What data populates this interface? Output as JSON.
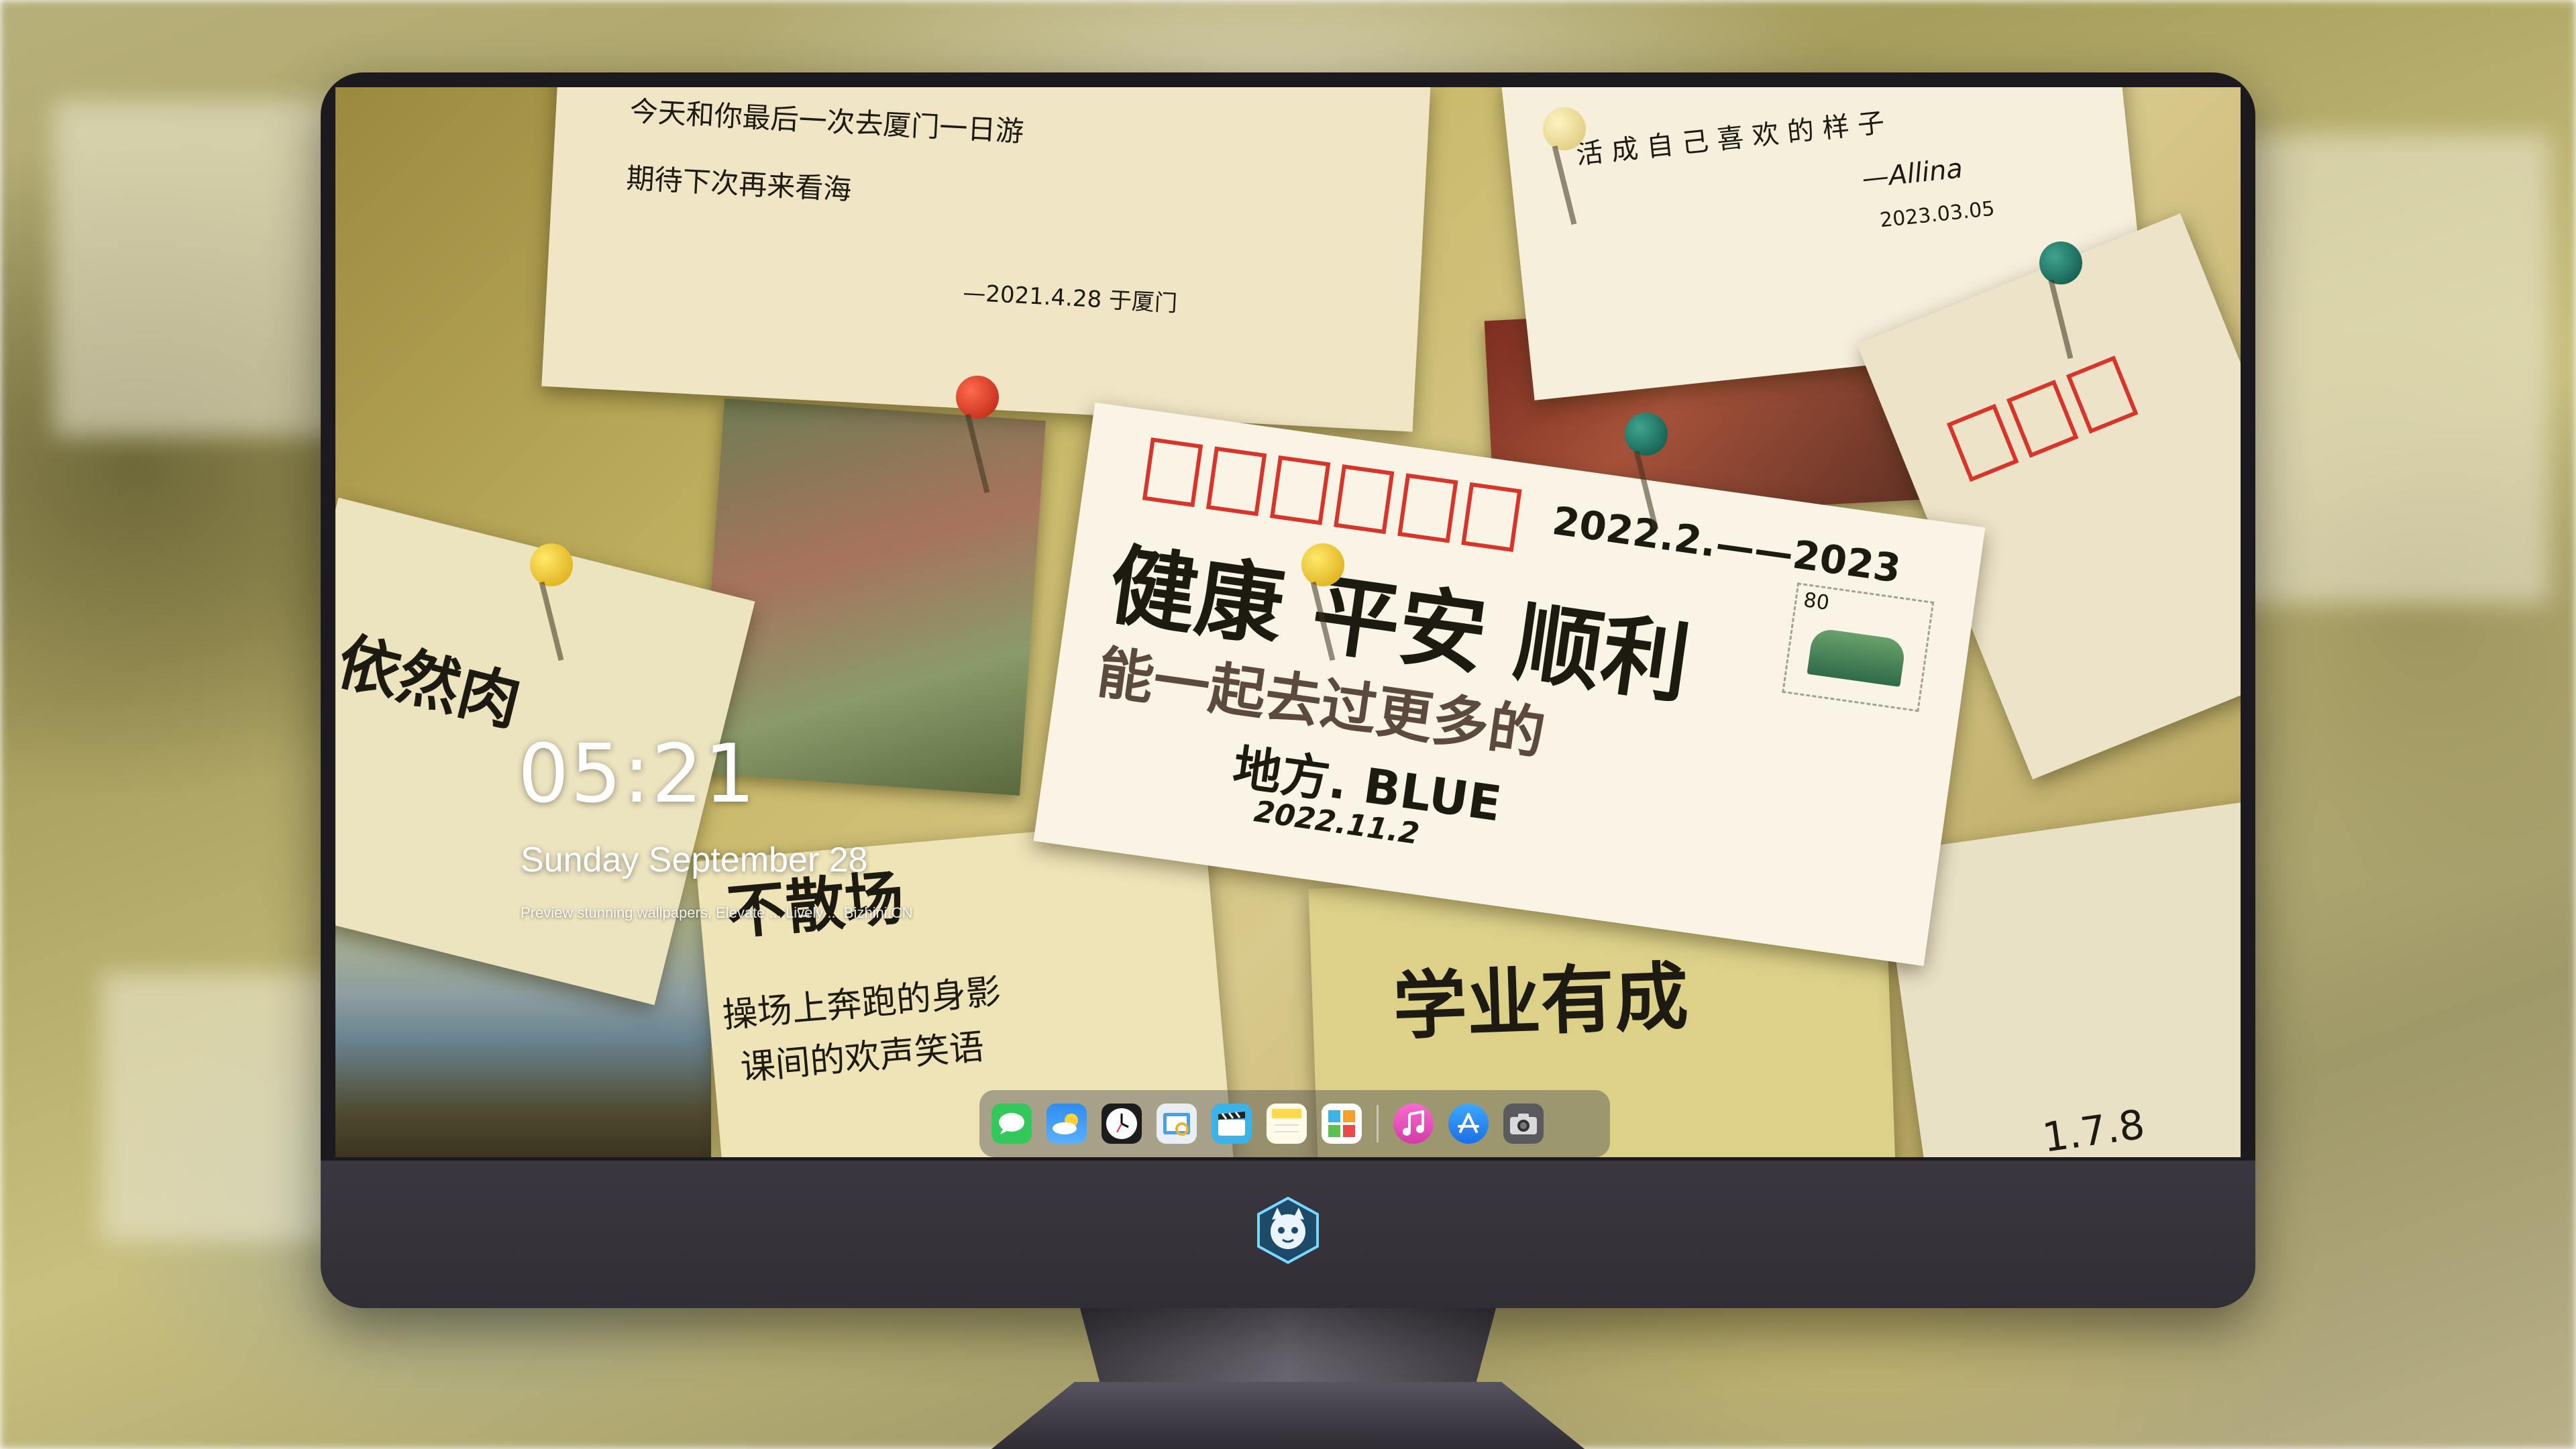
{
  "lock_screen": {
    "time": "05:21",
    "date": "Sunday September  28",
    "caption": "Preview stunning wallpapers, Elevate ... Lively ... Bizhini.CN"
  },
  "wallpaper_text": {
    "main_card_year": "2022.2.——2023",
    "main_card_line1": "健康 平安 顺利",
    "main_card_line2": "能一起去过更多的",
    "main_card_line3": "地方. BLUE",
    "main_card_date": "2022.11.2",
    "top_card_line1": "今天和你最后一次去厦门一日游",
    "top_card_line2": "期待下次再来看海",
    "top_card_sign": "—2021.4.28 于厦门",
    "right_card_line1": "活 成 自 己 喜 欢 的 样 子",
    "right_card_sign": "—Allina",
    "right_card_date": "2023.03.05",
    "left_text": "依然肉",
    "bottom_left_line1": "不散场",
    "bottom_left_line2": "操场上奔跑的身影",
    "bottom_left_line3": "课间的欢声笑语",
    "bottom_right_text": "学业有成",
    "stamp_value": "80",
    "bottom_corner_num": "1.7.8"
  },
  "dock": {
    "items": [
      {
        "name": "messages-icon",
        "color": "#34c759"
      },
      {
        "name": "weather-icon",
        "color": "#2f8cf0"
      },
      {
        "name": "clock-icon",
        "color": "#1c1c1e"
      },
      {
        "name": "preview-icon",
        "color": "#e9eef5"
      },
      {
        "name": "clips-icon",
        "color": "#3ab3e8"
      },
      {
        "name": "notes-icon",
        "color": "#ffd94a"
      },
      {
        "name": "photo-booth-icon",
        "color": "#ffffff"
      },
      {
        "name": "music-icon",
        "color": "#f44fb0"
      },
      {
        "name": "app-store-icon",
        "color": "#1e8cf5"
      },
      {
        "name": "camera-icon",
        "color": "#5a5a5e"
      }
    ]
  }
}
